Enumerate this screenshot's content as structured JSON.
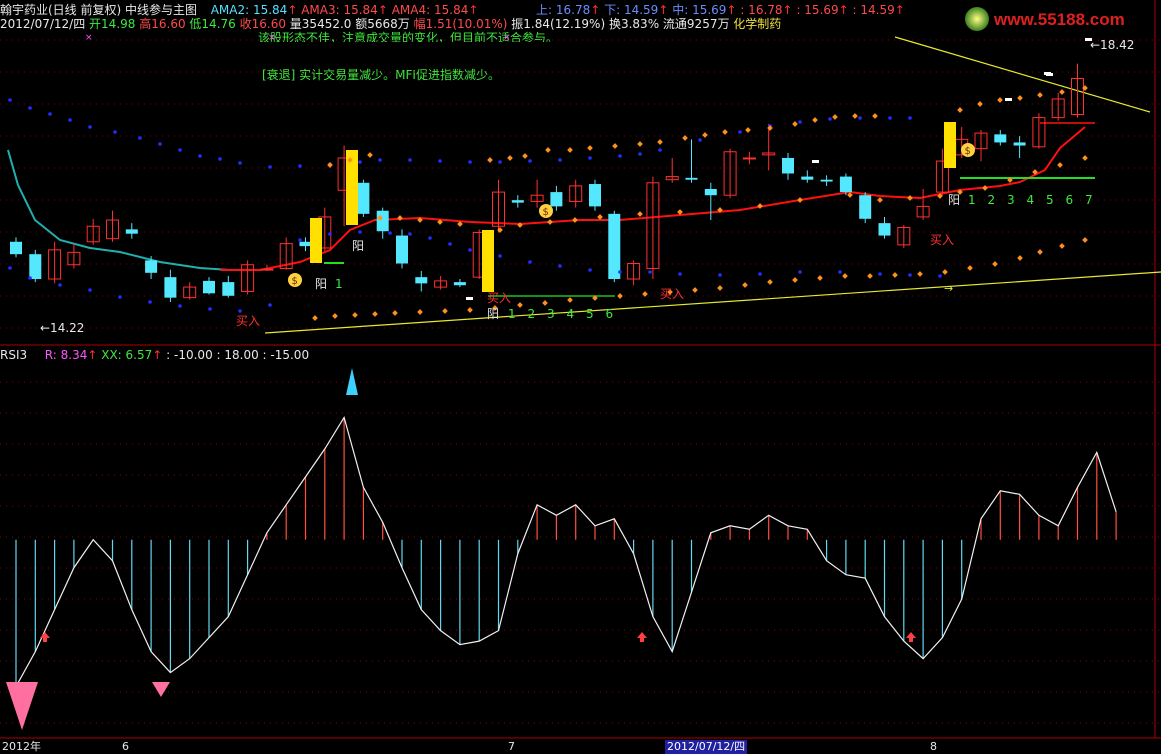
{
  "header": {
    "stock": "翰宇药业(日线 前复权)",
    "indicator": "中线参与主图",
    "ama2": "AMA2: 15.84",
    "ama3": "AMA3: 15.84",
    "ama4": "AMA4: 15.84",
    "upper": "上: 16.78",
    "lower": "下: 14.59",
    "mid": "中: 15.69",
    "v1": ": 16.78",
    "v2": ": 15.69",
    "v3": ": 14.59"
  },
  "info": {
    "date": "2012/07/12/四",
    "open": "开14.98",
    "high": "高16.60",
    "low": "低14.76",
    "close": "收16.60",
    "vol": "量35452.0",
    "amount": "额5668万",
    "change": "幅1.51(10.01%)",
    "amplitude": "振1.84(12.19%)",
    "turnover": "换3.83%",
    "float": "流通9257万",
    "sector": "化学制药"
  },
  "notes": {
    "top": "该股形态不佳，注意成交量的变化，但目前不适合参与。",
    "decline": "[衰退] 实计交易量减少。MFI促进指数减少。"
  },
  "logo_text": "www.55188.com",
  "labels": {
    "price_high": "18.42",
    "price_low": "14.22",
    "yang": "阳",
    "buy": "买入",
    "counts_a": [
      "1"
    ],
    "counts_b": [
      "1",
      "2",
      "3",
      "4",
      "5",
      "6"
    ],
    "counts_c": [
      "1",
      "2",
      "3",
      "4",
      "5",
      "6",
      "7"
    ]
  },
  "rsi": {
    "title": "RSI3",
    "r": "R: 8.34",
    "xx": "XX: 6.57",
    "params": ": -10.00  : 18.00  : -15.00"
  },
  "axis": {
    "labels": [
      "2012年",
      "6",
      "7",
      "2012/07/12/四",
      "8"
    ]
  },
  "colors": {
    "bg": "#000000",
    "up": "#ff3030",
    "down": "#54e8ff",
    "ma_red": "#ff1010",
    "ma_teal": "#20b0b0",
    "dot_blue": "#2030ff",
    "dot_orange": "#ff9020",
    "trend": "#e8e830",
    "grid": "#8a0000"
  },
  "chart_data": {
    "type": "candlestick",
    "title": "",
    "xlabel": "",
    "ylabel": "",
    "ylim": [
      14.0,
      18.8
    ],
    "candles": [
      {
        "o": 15.55,
        "c": 15.35,
        "h": 15.62,
        "l": 15.3
      },
      {
        "o": 15.35,
        "c": 14.95,
        "h": 15.42,
        "l": 14.9
      },
      {
        "o": 14.95,
        "c": 15.42,
        "h": 15.55,
        "l": 14.88
      },
      {
        "o": 15.18,
        "c": 15.38,
        "h": 15.52,
        "l": 15.12
      },
      {
        "o": 15.55,
        "c": 15.8,
        "h": 15.92,
        "l": 15.5
      },
      {
        "o": 15.6,
        "c": 15.9,
        "h": 16.05,
        "l": 15.55
      },
      {
        "o": 15.75,
        "c": 15.68,
        "h": 15.85,
        "l": 15.6
      },
      {
        "o": 15.25,
        "c": 15.05,
        "h": 15.32,
        "l": 14.95
      },
      {
        "o": 14.98,
        "c": 14.65,
        "h": 15.1,
        "l": 14.58
      },
      {
        "o": 14.65,
        "c": 14.82,
        "h": 14.9,
        "l": 14.62
      },
      {
        "o": 14.92,
        "c": 14.72,
        "h": 14.98,
        "l": 14.7
      },
      {
        "o": 14.9,
        "c": 14.68,
        "h": 15.0,
        "l": 14.65
      },
      {
        "o": 14.75,
        "c": 15.18,
        "h": 15.25,
        "l": 14.7
      },
      {
        "o": 15.1,
        "c": 15.11,
        "h": 15.18,
        "l": 15.08
      },
      {
        "o": 15.12,
        "c": 15.52,
        "h": 15.62,
        "l": 15.1
      },
      {
        "o": 15.55,
        "c": 15.48,
        "h": 15.62,
        "l": 15.4
      },
      {
        "o": 15.45,
        "c": 15.95,
        "h": 16.1,
        "l": 15.4
      },
      {
        "o": 16.38,
        "c": 16.9,
        "h": 17.1,
        "l": 15.8
      },
      {
        "o": 16.5,
        "c": 16.0,
        "h": 16.55,
        "l": 15.95
      },
      {
        "o": 16.05,
        "c": 15.72,
        "h": 16.1,
        "l": 15.6
      },
      {
        "o": 15.65,
        "c": 15.2,
        "h": 15.75,
        "l": 15.12
      },
      {
        "o": 14.98,
        "c": 14.88,
        "h": 15.08,
        "l": 14.75
      },
      {
        "o": 14.82,
        "c": 14.92,
        "h": 15.0,
        "l": 14.78
      },
      {
        "o": 14.9,
        "c": 14.85,
        "h": 14.95,
        "l": 14.82
      },
      {
        "o": 14.98,
        "c": 15.7,
        "h": 15.75,
        "l": 14.95
      },
      {
        "o": 15.8,
        "c": 16.35,
        "h": 16.55,
        "l": 15.7
      },
      {
        "o": 16.22,
        "c": 16.18,
        "h": 16.3,
        "l": 16.1
      },
      {
        "o": 16.2,
        "c": 16.3,
        "h": 16.55,
        "l": 16.1
      },
      {
        "o": 16.35,
        "c": 16.12,
        "h": 16.45,
        "l": 16.05
      },
      {
        "o": 16.2,
        "c": 16.45,
        "h": 16.55,
        "l": 16.1
      },
      {
        "o": 16.48,
        "c": 16.12,
        "h": 16.55,
        "l": 16.05
      },
      {
        "o": 16.0,
        "c": 14.95,
        "h": 16.05,
        "l": 14.9
      },
      {
        "o": 14.95,
        "c": 15.2,
        "h": 15.25,
        "l": 14.85
      },
      {
        "o": 15.12,
        "c": 16.5,
        "h": 16.6,
        "l": 14.95
      },
      {
        "o": 16.55,
        "c": 16.6,
        "h": 16.9,
        "l": 16.5
      },
      {
        "o": 16.58,
        "c": 16.55,
        "h": 17.2,
        "l": 16.5
      },
      {
        "o": 16.4,
        "c": 16.3,
        "h": 16.5,
        "l": 15.9
      },
      {
        "o": 16.3,
        "c": 17.0,
        "h": 17.05,
        "l": 16.25
      },
      {
        "o": 16.9,
        "c": 16.9,
        "h": 17.0,
        "l": 16.8
      },
      {
        "o": 16.95,
        "c": 16.98,
        "h": 17.45,
        "l": 16.7
      },
      {
        "o": 16.9,
        "c": 16.65,
        "h": 16.98,
        "l": 16.55
      },
      {
        "o": 16.6,
        "c": 16.55,
        "h": 16.7,
        "l": 16.5
      },
      {
        "o": 16.55,
        "c": 16.52,
        "h": 16.62,
        "l": 16.45
      },
      {
        "o": 16.6,
        "c": 16.35,
        "h": 16.65,
        "l": 16.3
      },
      {
        "o": 16.3,
        "c": 15.92,
        "h": 16.35,
        "l": 15.85
      },
      {
        "o": 15.85,
        "c": 15.65,
        "h": 15.95,
        "l": 15.6
      },
      {
        "o": 15.5,
        "c": 15.78,
        "h": 15.82,
        "l": 15.45
      },
      {
        "o": 15.95,
        "c": 16.12,
        "h": 16.4,
        "l": 15.9
      },
      {
        "o": 16.35,
        "c": 16.85,
        "h": 17.05,
        "l": 16.3
      },
      {
        "o": 16.95,
        "c": 17.2,
        "h": 17.4,
        "l": 16.9
      },
      {
        "o": 17.05,
        "c": 17.3,
        "h": 17.35,
        "l": 16.85
      },
      {
        "o": 17.28,
        "c": 17.15,
        "h": 17.35,
        "l": 17.1
      },
      {
        "o": 17.15,
        "c": 17.1,
        "h": 17.25,
        "l": 16.9
      },
      {
        "o": 17.08,
        "c": 17.55,
        "h": 17.62,
        "l": 17.05
      },
      {
        "o": 17.55,
        "c": 17.85,
        "h": 17.95,
        "l": 17.5
      },
      {
        "o": 17.6,
        "c": 18.18,
        "h": 18.42,
        "l": 17.55
      }
    ],
    "rsi_values": [
      8,
      18,
      30,
      42,
      50,
      44,
      30,
      18,
      12,
      16,
      22,
      28,
      40,
      52,
      60,
      68,
      76,
      85,
      65,
      55,
      42,
      30,
      24,
      20,
      21,
      24,
      46,
      60,
      57,
      60,
      54,
      56,
      46,
      28,
      18,
      35,
      52,
      54,
      53,
      57,
      54,
      53,
      44,
      40,
      39,
      28,
      21,
      16,
      22,
      33,
      56,
      64,
      63,
      57,
      54,
      65,
      75,
      58
    ]
  }
}
